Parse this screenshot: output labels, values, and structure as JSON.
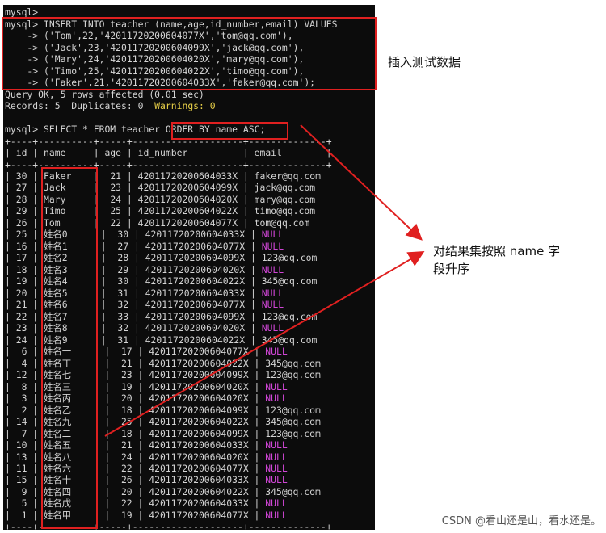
{
  "terminal": {
    "prompt_top": "mysql>",
    "insert_command": "mysql> INSERT INTO teacher (name,age,id_number,email) VALUES",
    "insert_values": [
      "    -> ('Tom',22,'42011720200604077X','tom@qq.com'),",
      "    -> ('Jack',23,'42011720200604099X','jack@qq.com'),",
      "    -> ('Mary',24,'42011720200604020X','mary@qq.com'),",
      "    -> ('Timo',25,'42011720200604022X','timo@qq.com'),",
      "    -> ('Faker',21,'42011720200604033X','faker@qq.com');"
    ],
    "query_ok": "Query OK, 5 rows affected (0.01 sec)",
    "records_prefix": "Records: 5  Duplicates: 0  ",
    "warnings": "Warnings: 0",
    "select_command": "mysql> SELECT * FROM teacher ORDER BY name ASC;",
    "table_border": "+----+----------+-----+--------------------+--------------+",
    "table_header": "| id | name     | age | id_number          | email        |",
    "rows": [
      {
        "id": "30",
        "name": "Faker",
        "age": "21",
        "id_number": "42011720200604033X",
        "email": "faker@qq.com"
      },
      {
        "id": "27",
        "name": "Jack",
        "age": "23",
        "id_number": "42011720200604099X",
        "email": "jack@qq.com"
      },
      {
        "id": "28",
        "name": "Mary",
        "age": "24",
        "id_number": "42011720200604020X",
        "email": "mary@qq.com"
      },
      {
        "id": "29",
        "name": "Timo",
        "age": "25",
        "id_number": "42011720200604022X",
        "email": "timo@qq.com"
      },
      {
        "id": "26",
        "name": "Tom",
        "age": "22",
        "id_number": "42011720200604077X",
        "email": "tom@qq.com"
      },
      {
        "id": "25",
        "name": "姓名0",
        "age": "30",
        "id_number": "42011720200604033X",
        "email": "NULL"
      },
      {
        "id": "16",
        "name": "姓名1",
        "age": "27",
        "id_number": "42011720200604077X",
        "email": "NULL"
      },
      {
        "id": "17",
        "name": "姓名2",
        "age": "28",
        "id_number": "42011720200604099X",
        "email": "123@qq.com"
      },
      {
        "id": "18",
        "name": "姓名3",
        "age": "29",
        "id_number": "42011720200604020X",
        "email": "NULL"
      },
      {
        "id": "19",
        "name": "姓名4",
        "age": "30",
        "id_number": "42011720200604022X",
        "email": "345@qq.com"
      },
      {
        "id": "20",
        "name": "姓名5",
        "age": "31",
        "id_number": "42011720200604033X",
        "email": "NULL"
      },
      {
        "id": "21",
        "name": "姓名6",
        "age": "32",
        "id_number": "42011720200604077X",
        "email": "NULL"
      },
      {
        "id": "22",
        "name": "姓名7",
        "age": "33",
        "id_number": "42011720200604099X",
        "email": "123@qq.com"
      },
      {
        "id": "23",
        "name": "姓名8",
        "age": "32",
        "id_number": "42011720200604020X",
        "email": "NULL"
      },
      {
        "id": "24",
        "name": "姓名9",
        "age": "31",
        "id_number": "42011720200604022X",
        "email": "345@qq.com"
      },
      {
        "id": "6",
        "name": "姓名一",
        "age": "17",
        "id_number": "42011720200604077X",
        "email": "NULL"
      },
      {
        "id": "4",
        "name": "姓名丁",
        "age": "21",
        "id_number": "42011720200604022X",
        "email": "345@qq.com"
      },
      {
        "id": "12",
        "name": "姓名七",
        "age": "23",
        "id_number": "42011720200604099X",
        "email": "123@qq.com"
      },
      {
        "id": "8",
        "name": "姓名三",
        "age": "19",
        "id_number": "42011720200604020X",
        "email": "NULL"
      },
      {
        "id": "3",
        "name": "姓名丙",
        "age": "20",
        "id_number": "42011720200604020X",
        "email": "NULL"
      },
      {
        "id": "2",
        "name": "姓名乙",
        "age": "18",
        "id_number": "42011720200604099X",
        "email": "123@qq.com"
      },
      {
        "id": "14",
        "name": "姓名九",
        "age": "25",
        "id_number": "42011720200604022X",
        "email": "345@qq.com"
      },
      {
        "id": "7",
        "name": "姓名二",
        "age": "18",
        "id_number": "42011720200604099X",
        "email": "123@qq.com"
      },
      {
        "id": "10",
        "name": "姓名五",
        "age": "21",
        "id_number": "42011720200604033X",
        "email": "NULL"
      },
      {
        "id": "13",
        "name": "姓名八",
        "age": "24",
        "id_number": "42011720200604020X",
        "email": "NULL"
      },
      {
        "id": "11",
        "name": "姓名六",
        "age": "22",
        "id_number": "42011720200604077X",
        "email": "NULL"
      },
      {
        "id": "15",
        "name": "姓名十",
        "age": "26",
        "id_number": "42011720200604033X",
        "email": "NULL"
      },
      {
        "id": "9",
        "name": "姓名四",
        "age": "20",
        "id_number": "42011720200604022X",
        "email": "345@qq.com"
      },
      {
        "id": "5",
        "name": "姓名戊",
        "age": "22",
        "id_number": "42011720200604033X",
        "email": "NULL"
      },
      {
        "id": "1",
        "name": "姓名甲",
        "age": "19",
        "id_number": "42011720200604077X",
        "email": "NULL"
      }
    ]
  },
  "annotations": {
    "insert_note": "插入测试数据",
    "sort_note_line1": "对结果集按照 name 字",
    "sort_note_line2": "段升序"
  },
  "watermark": "CSDN @看山还是山，看水还是。",
  "colors": {
    "terminal_bg": "#0c0c0c",
    "terminal_text": "#d4d4d4",
    "null_text": "#d046d6",
    "warnings_text": "#e8d048",
    "highlight": "#e02020"
  }
}
